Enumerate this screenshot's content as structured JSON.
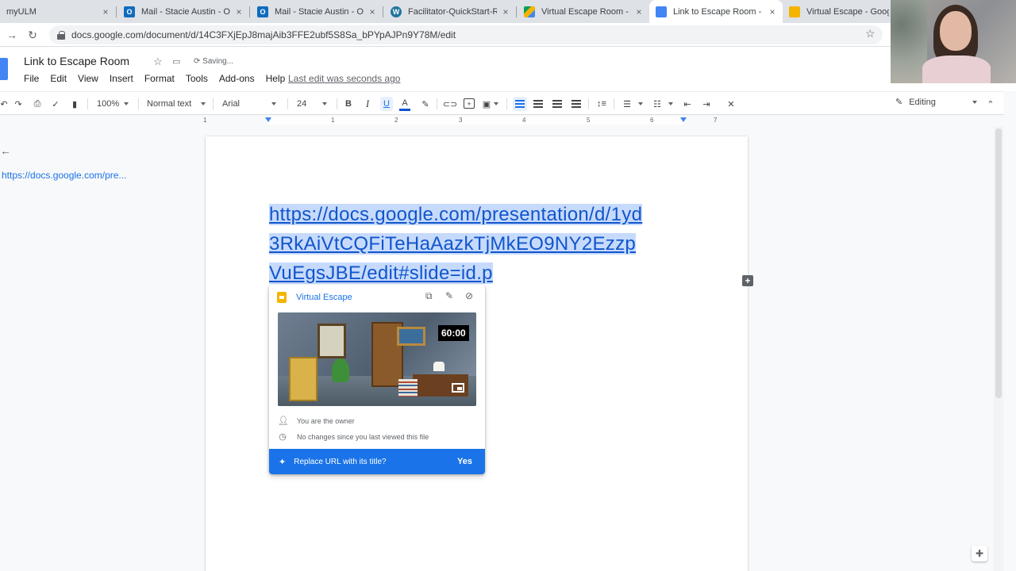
{
  "browser": {
    "tabs": [
      {
        "title": "myULM",
        "favicon": "myulm",
        "active": false
      },
      {
        "title": "Mail - Stacie Austin - Out",
        "favicon": "outlook-icon",
        "active": false
      },
      {
        "title": "Mail - Stacie Austin - Out",
        "favicon": "outlook-icon",
        "active": false
      },
      {
        "title": "Facilitator-QuickStart-Re",
        "favicon": "wordpress-icon",
        "active": false
      },
      {
        "title": "Virtual Escape Room - Go",
        "favicon": "drive-icon",
        "active": false
      },
      {
        "title": "Link to Escape Room - Go",
        "favicon": "docs-icon",
        "active": true
      },
      {
        "title": "Virtual Escape - Google",
        "favicon": "slides-icon",
        "active": false
      }
    ],
    "url": "docs.google.com/document/d/14C3FXjEpJ8majAib3FFE2ubf5S8Sa_bPYpAJPn9Y78M/edit",
    "close_glyph": "×"
  },
  "docs": {
    "title": "Link to Escape Room",
    "saving": "Saving...",
    "menu": [
      "File",
      "Edit",
      "View",
      "Insert",
      "Format",
      "Tools",
      "Add-ons",
      "Help"
    ],
    "last_edit": "Last edit was seconds ago",
    "toolbar": {
      "zoom": "100%",
      "style": "Normal text",
      "font": "Arial",
      "size": "24",
      "mode": "Editing"
    },
    "ruler_numbers": [
      "1",
      "1",
      "2",
      "3",
      "4",
      "5",
      "6",
      "7"
    ],
    "outline_link": "https://docs.google.com/pre...",
    "link_lines": [
      "https://docs.google.com/presentation/d/1yd",
      "3RkAiVtCQFiTeHaAazkTjMkEO9NY2Ezzp",
      "VuEgsJBE/edit#slide=id.p"
    ]
  },
  "preview_card": {
    "title": "Virtual Escape",
    "timer": "60:00",
    "owner_text": "You are the owner",
    "changes_text": "No changes since you last viewed this file",
    "replace_prompt": "Replace URL with its title?",
    "yes_label": "Yes"
  },
  "colors": {
    "link": "#1155cc",
    "selection": "#c6dafc",
    "accent": "#1a73e8",
    "slides_yellow": "#f4b400"
  }
}
